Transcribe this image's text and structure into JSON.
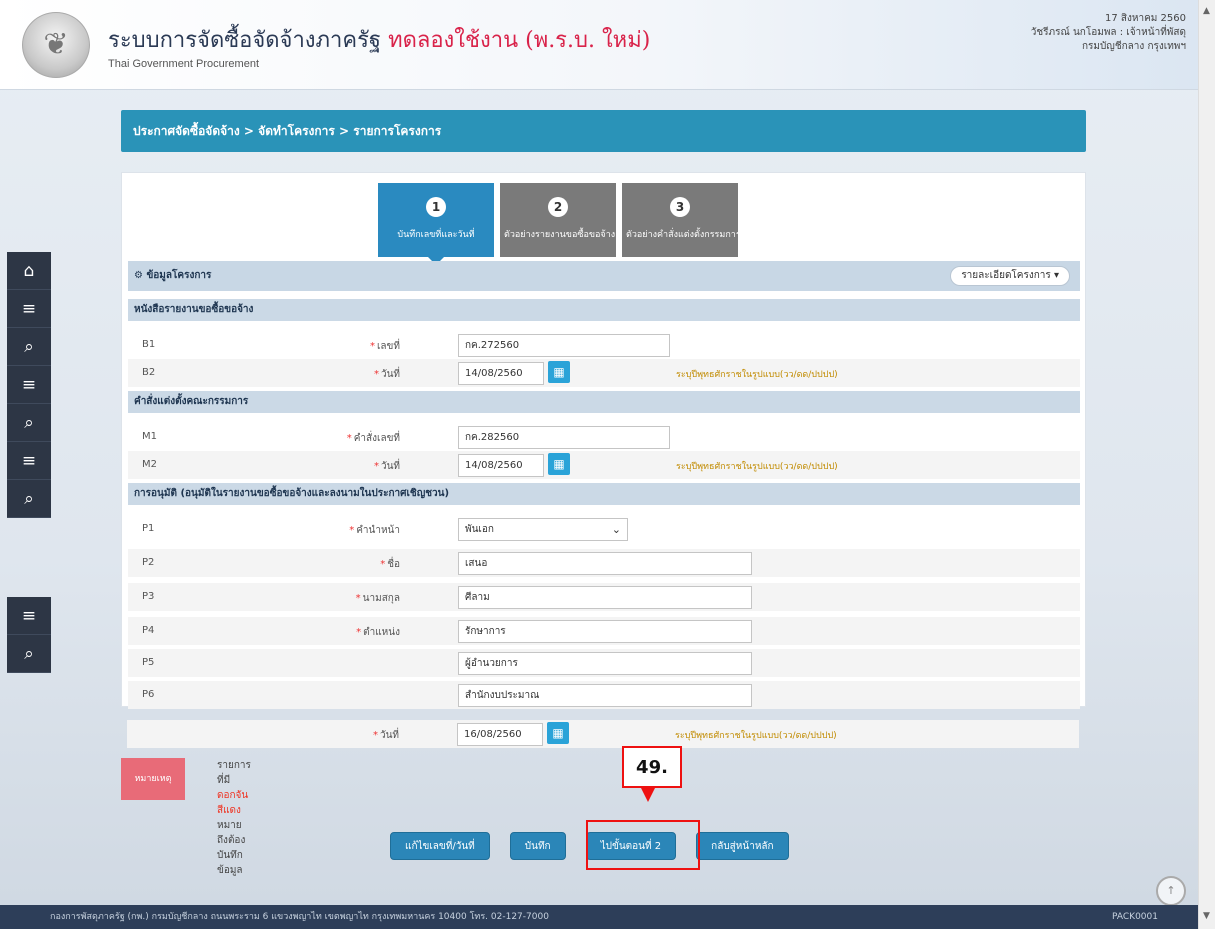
{
  "header": {
    "title_main": "ระบบการจัดซื้อจัดจ้างภาครัฐ",
    "title_trial": "ทดลองใช้งาน (พ.ร.บ. ใหม่)",
    "subtitle": "Thai Government Procurement",
    "user_line1": "17 สิงหาคม 2560",
    "user_line2": "วัชรีภรณ์ นกโอมพล : เจ้าหน้าที่พัสดุ",
    "user_line3": "กรมบัญชีกลาง กรุงเทพฯ"
  },
  "breadcrumb": "ประกาศจัดซื้อจัดจ้าง > จัดทำโครงการ > รายการโครงการ",
  "steps": [
    {
      "num": "1",
      "label": "บันทึกเลขที่และวันที่",
      "active": true
    },
    {
      "num": "2",
      "label": "ตัวอย่างรายงานขอซื้อขอจ้าง",
      "active": false
    },
    {
      "num": "3",
      "label": "ตัวอย่างคำสั่งแต่งตั้งกรรมการ",
      "active": false
    }
  ],
  "project_info": {
    "title": "ข้อมูลโครงการ",
    "menu": "รายละเอียดโครงการ ▾"
  },
  "sections": {
    "report": "หนังสือรายงานขอซื้อขอจ้าง",
    "committee": "คำสั่งแต่งตั้งคณะกรรมการ",
    "approval": "การอนุมัติ (อนุมัติในรายงานขอซื้อขอจ้างและลงนามในประกาศเชิญชวน)"
  },
  "rows": {
    "b1": {
      "code": "B1",
      "label": "เลขที่",
      "value": "กค.272560"
    },
    "b2": {
      "code": "B2",
      "label": "วันที่",
      "value": "14/08/2560",
      "hint": "ระบุปีพุทธศักราชในรูปแบบ(วว/ดด/ปปปป)"
    },
    "m1": {
      "code": "M1",
      "label": "คำสั่งเลขที่",
      "value": "กค.282560"
    },
    "m2": {
      "code": "M2",
      "label": "วันที่",
      "value": "14/08/2560",
      "hint": "ระบุปีพุทธศักราชในรูปแบบ(วว/ดด/ปปปป)"
    },
    "p1": {
      "code": "P1",
      "label": "คำนำหน้า",
      "value": "พันเอก"
    },
    "p2": {
      "code": "P2",
      "label": "ชื่อ",
      "value": "เสนอ"
    },
    "p3": {
      "code": "P3",
      "label": "นามสกุล",
      "value": "ศีลาม"
    },
    "p4": {
      "code": "P4",
      "label": "ตำแหน่ง",
      "value": "รักษาการ"
    },
    "p5": {
      "code": "P5",
      "label": "",
      "value": "ผู้อำนวยการ"
    },
    "p6": {
      "code": "P6",
      "label": "",
      "value": "สำนักงบประมาณ"
    },
    "date": {
      "code": "",
      "label": "วันที่",
      "value": "16/08/2560",
      "hint": "ระบุปีพุทธศักราชในรูปแบบ(วว/ดด/ปปปป)"
    }
  },
  "note": {
    "tag": "หมายเหตุ",
    "text_before": "รายการที่มี",
    "text_red": "ดอกจันสีแดง",
    "text_after": "หมายถึงต้องบันทึกข้อมูล"
  },
  "buttons": {
    "reset": "แก้ไขเลขที่/วันที่",
    "save": "บันทึก",
    "next": "ไปขั้นตอนที่ 2",
    "home": "กลับสู่หน้าหลัก"
  },
  "callout": "49.",
  "footer": {
    "left": "กองการพัสดุภาครัฐ (กพ.) กรมบัญชีกลาง ถนนพระราม 6 แขวงพญาไท เขตพญาไท กรุงเทพมหานคร 10400 โทร. 02-127-7000",
    "right": "PACK0001"
  },
  "colors": {
    "primary": "#2b86b8",
    "breadcrumb": "#2a93b8",
    "highlight": "#e11111",
    "trial": "#d9234a"
  }
}
